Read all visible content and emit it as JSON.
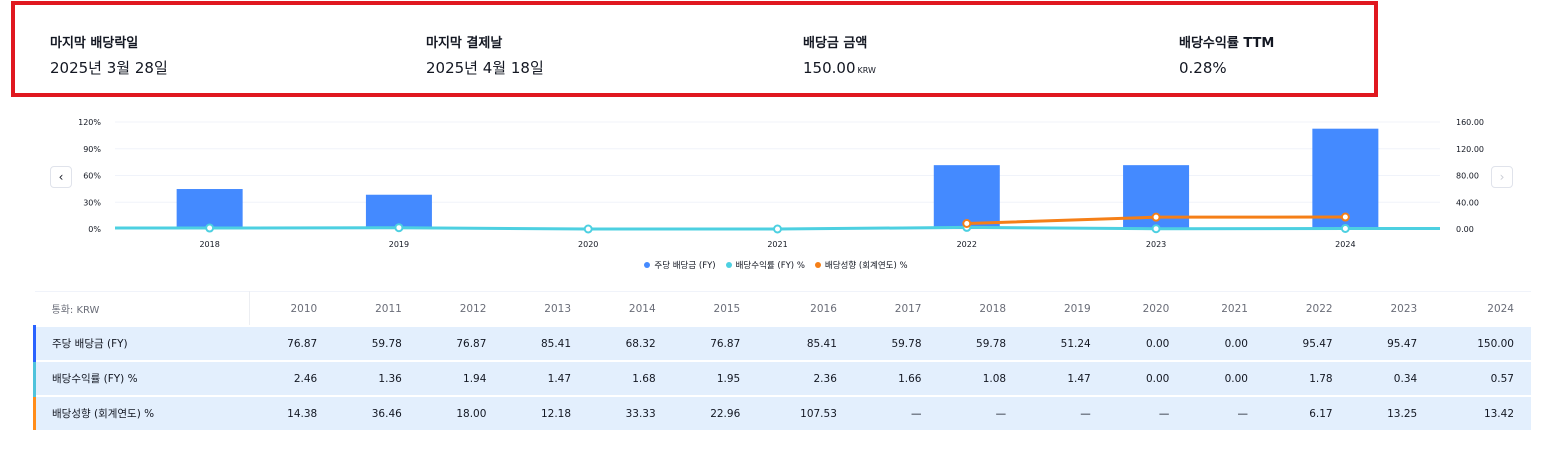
{
  "summary": {
    "last_ex_date": {
      "label": "마지막 배당락일",
      "value": "2025년 3월 28일"
    },
    "last_pay_date": {
      "label": "마지막 결제날",
      "value": "2025년 4월 18일"
    },
    "dividend_amount": {
      "label": "배당금 금액",
      "value": "150.00",
      "unit": "KRW"
    },
    "yield_ttm": {
      "label": "배당수익률 TTM",
      "value": "0.28%"
    }
  },
  "nav": {
    "prev": "‹",
    "next": "›"
  },
  "chart_data": {
    "type": "bar",
    "categories": [
      "2018",
      "2019",
      "2020",
      "2021",
      "2022",
      "2023",
      "2024"
    ],
    "series": [
      {
        "name": "주당 배당금 (FY)",
        "type": "bar",
        "axis": "right",
        "color": "#448aff",
        "values": [
          59.78,
          51.24,
          0.0,
          0.0,
          95.47,
          95.47,
          150.0
        ]
      },
      {
        "name": "배당수익률 (FY) %",
        "type": "line",
        "axis": "left",
        "color": "#4dd0e1",
        "values": [
          1.08,
          1.47,
          0.0,
          0.0,
          1.78,
          0.34,
          0.57
        ]
      },
      {
        "name": "배당성향 (회계연도) %",
        "type": "line",
        "axis": "left",
        "color": "#f57f17",
        "values": [
          null,
          null,
          null,
          null,
          6.17,
          13.25,
          13.42
        ]
      }
    ],
    "left_axis": {
      "ticks": [
        "0%",
        "30%",
        "60%",
        "90%",
        "120%"
      ],
      "ylim": [
        0,
        120
      ]
    },
    "right_axis": {
      "ticks": [
        "0.00",
        "40.00",
        "80.00",
        "120.00",
        "160.00"
      ],
      "ylim": [
        0,
        160
      ]
    },
    "legend_position": "bottom",
    "grid": true
  },
  "table": {
    "currency_label": "통화: KRW",
    "years": [
      "2010",
      "2011",
      "2012",
      "2013",
      "2014",
      "2015",
      "2016",
      "2017",
      "2018",
      "2019",
      "2020",
      "2021",
      "2022",
      "2023",
      "2024"
    ],
    "rows": [
      {
        "label": "주당 배당금 (FY)",
        "values": [
          "76.87",
          "59.78",
          "76.87",
          "85.41",
          "68.32",
          "76.87",
          "85.41",
          "59.78",
          "59.78",
          "51.24",
          "0.00",
          "0.00",
          "95.47",
          "95.47",
          "150.00"
        ]
      },
      {
        "label": "배당수익률 (FY) %",
        "values": [
          "2.46",
          "1.36",
          "1.94",
          "1.47",
          "1.68",
          "1.95",
          "2.36",
          "1.66",
          "1.08",
          "1.47",
          "0.00",
          "0.00",
          "1.78",
          "0.34",
          "0.57"
        ]
      },
      {
        "label": "배당성향 (회계연도) %",
        "values": [
          "14.38",
          "36.46",
          "18.00",
          "12.18",
          "33.33",
          "22.96",
          "107.53",
          "—",
          "—",
          "—",
          "—",
          "—",
          "6.17",
          "13.25",
          "13.42"
        ]
      }
    ]
  }
}
